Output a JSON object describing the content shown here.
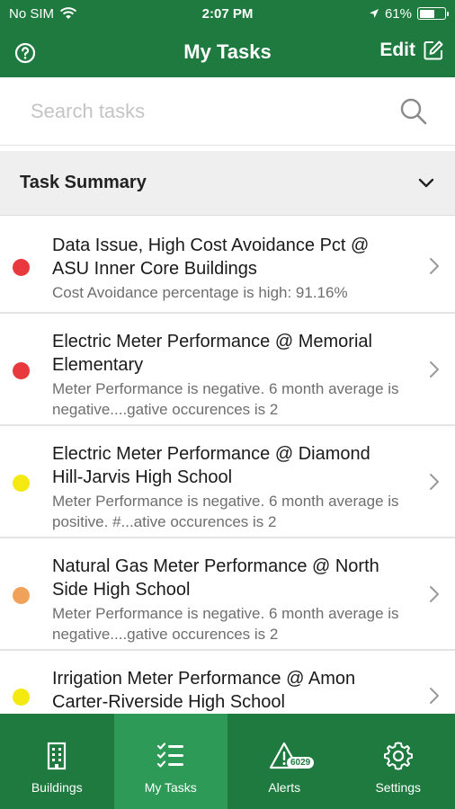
{
  "status_bar": {
    "carrier": "No SIM",
    "time": "2:07 PM",
    "battery": "61%",
    "battery_level": 0.61,
    "icons": [
      "wifi-icon",
      "location-arrow-icon",
      "battery-icon"
    ]
  },
  "nav": {
    "title": "My Tasks",
    "edit_label": "Edit",
    "help_icon": "question-circle-icon",
    "edit_icon": "edit-square-icon"
  },
  "search": {
    "placeholder": "Search tasks",
    "value": ""
  },
  "summary": {
    "label": "Task Summary",
    "icon": "chevron-down-icon"
  },
  "tasks": [
    {
      "title": "Data Issue, High Cost Avoidance Pct @ ASU Inner Core Buildings",
      "description": "Cost Avoidance percentage is high: 91.16%",
      "status_color": "#e8393f"
    },
    {
      "title": "Electric Meter Performance @ Memorial Elementary",
      "description": "Meter Performance is negative. 6 month average is negative....gative occurences is 2",
      "status_color": "#e8393f"
    },
    {
      "title": "Electric Meter Performance @ Diamond Hill-Jarvis High School",
      "description": "Meter Performance is negative. 6 month average is positive. #...ative occurences is 2",
      "status_color": "#f4ea12"
    },
    {
      "title": "Natural Gas Meter Performance @ North Side High School",
      "description": "Meter Performance is negative. 6 month average is negative....gative occurences is 2",
      "status_color": "#f0a25a"
    },
    {
      "title": "Irrigation Meter Performance @ Amon Carter-Riverside High School",
      "description": "",
      "status_color": "#f4ea12"
    }
  ],
  "tabs": [
    {
      "label": "Buildings",
      "icon": "building-icon",
      "active": false
    },
    {
      "label": "My Tasks",
      "icon": "task-list-icon",
      "active": true
    },
    {
      "label": "Alerts",
      "icon": "alert-triangle-icon",
      "active": false,
      "badge": "6029"
    },
    {
      "label": "Settings",
      "icon": "gear-icon",
      "active": false
    }
  ],
  "colors": {
    "brand_green": "#1e7a3e",
    "active_tab_green": "#2e9a57",
    "red": "#e8393f",
    "yellow": "#f4ea12",
    "orange": "#f0a25a"
  }
}
